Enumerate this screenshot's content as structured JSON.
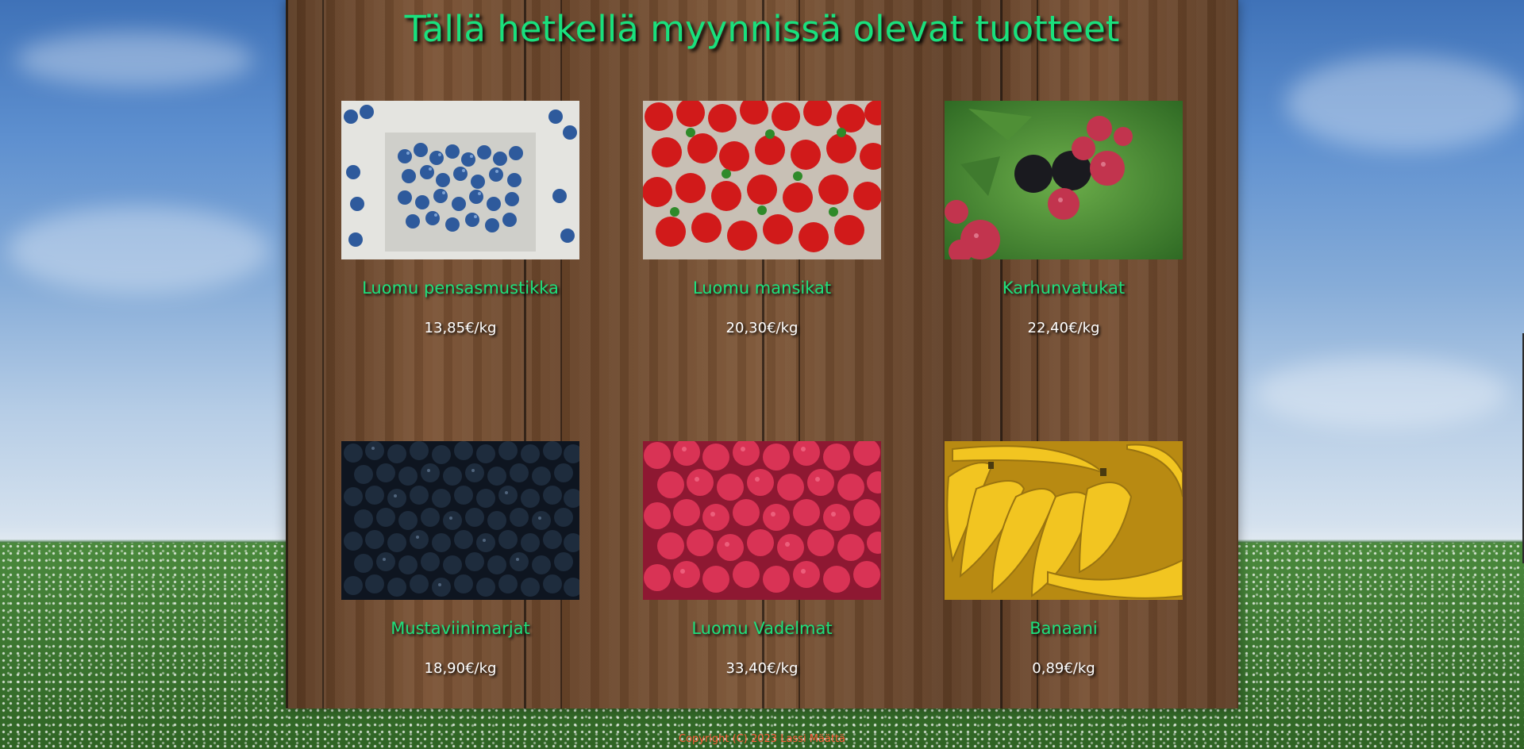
{
  "page": {
    "title": "Tällä hetkellä myynnissä olevat tuotteet",
    "footer": "Copyright (C) 2023 Lassi Määttä"
  },
  "products": [
    {
      "name": "Luomu pensasmustikka",
      "price": "13,85€/kg",
      "image": "blueberries-photo"
    },
    {
      "name": "Luomu mansikat",
      "price": "20,30€/kg",
      "image": "strawberries-photo"
    },
    {
      "name": "Karhunvatukat",
      "price": "22,40€/kg",
      "image": "blackberries-photo"
    },
    {
      "name": "Mustaviinimarjat",
      "price": "18,90€/kg",
      "image": "blackcurrants-photo"
    },
    {
      "name": "Luomu Vadelmat",
      "price": "33,40€/kg",
      "image": "raspberries-photo"
    },
    {
      "name": "Banaani",
      "price": "0,89€/kg",
      "image": "bananas-photo"
    }
  ],
  "colors": {
    "title": "#19e07d",
    "product_name": "#1ee07c",
    "price": "#ffffff",
    "footer": "#ff5a3a"
  }
}
